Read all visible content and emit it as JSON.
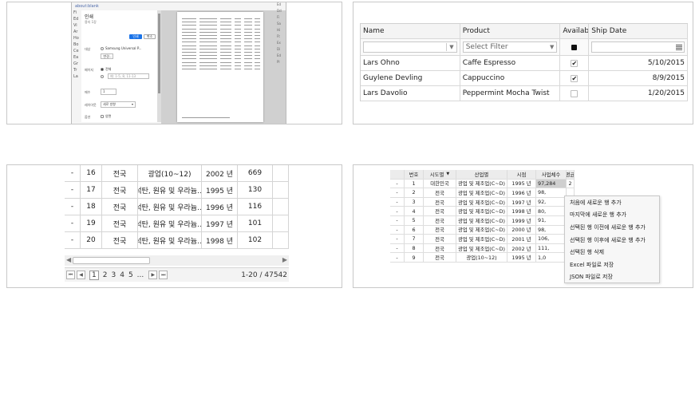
{
  "print_dialog": {
    "titlebar": "about:blank",
    "left_labels": [
      "Fi",
      "Ed",
      "Vi",
      "Ar",
      "Ho",
      "Bo",
      "Ce",
      "Ea",
      "Gr",
      "Tr",
      "La"
    ],
    "heading": "인쇄",
    "sub": "용지 1장",
    "print_btn": "인쇄",
    "cancel_btn": "취소",
    "dest_label": "대상",
    "dest_value": "Samsung Universal P...",
    "change_btn": "변경...",
    "pages_label": "페이지",
    "pages_all": "전체",
    "pages_example": "예: 1-5, 8, 11-13",
    "copies_label": "매수",
    "copies_value": "1",
    "layout_label": "레이아웃",
    "layout_value": "세로 방향",
    "color_label": "옵션",
    "color_value": "양면",
    "right_labels": [
      "Ed",
      "Dd",
      "Fi",
      "Sa",
      "Hi",
      "Ft",
      "Ex",
      "Di",
      "Ed",
      "Pl"
    ]
  },
  "filter_grid": {
    "columns": [
      "Name",
      "Product",
      "Available",
      "Ship Date"
    ],
    "filter_placeholder": "Select Filter",
    "rows": [
      {
        "name": "Lars Ohno",
        "product": "Caffe Espresso",
        "available": true,
        "date": "5/10/2015"
      },
      {
        "name": "Guylene Devling",
        "product": "Cappuccino",
        "available": true,
        "date": "8/9/2015"
      },
      {
        "name": "Lars Davolio",
        "product": "Peppermint Mocha Twist",
        "available": false,
        "date": "1/20/2015"
      }
    ]
  },
  "paged_table": {
    "rows": [
      {
        "d": "-",
        "no": "16",
        "region": "전국",
        "industry": "광업(10~12)",
        "year": "2002 년",
        "value": "669"
      },
      {
        "d": "-",
        "no": "17",
        "region": "전국",
        "industry": "석탄, 원유 및 우라늄...",
        "year": "1995 년",
        "value": "130"
      },
      {
        "d": "-",
        "no": "18",
        "region": "전국",
        "industry": "석탄, 원유 및 우라늄...",
        "year": "1996 년",
        "value": "116"
      },
      {
        "d": "-",
        "no": "19",
        "region": "전국",
        "industry": "석탄, 원유 및 우라늄...",
        "year": "1997 년",
        "value": "101"
      },
      {
        "d": "-",
        "no": "20",
        "region": "전국",
        "industry": "석탄, 원유 및 우라늄...",
        "year": "1998 년",
        "value": "102"
      }
    ],
    "pager": {
      "first": "⏮",
      "prev": "◀",
      "pages": [
        "1",
        "2",
        "3",
        "4",
        "5"
      ],
      "current": "1",
      "more": "...",
      "next": "▶",
      "last": "⏭",
      "info": "1-20 / 47542"
    }
  },
  "context_grid": {
    "columns": [
      "번호",
      "시도별",
      "산업별",
      "시점",
      "사업체수",
      "평균"
    ],
    "rows": [
      {
        "d": "-",
        "no": "1",
        "region": "대한민국",
        "industry": "광업 및 제조업(C~D)",
        "year": "1995 년",
        "cnt": "97,284",
        "ex": "2"
      },
      {
        "d": "-",
        "no": "2",
        "region": "전국",
        "industry": "광업 및 제조업(C~D)",
        "year": "1996 년",
        "cnt": "98,",
        "ex": ""
      },
      {
        "d": "-",
        "no": "3",
        "region": "전국",
        "industry": "광업 및 제조업(C~D)",
        "year": "1997 년",
        "cnt": "92,",
        "ex": ""
      },
      {
        "d": "-",
        "no": "4",
        "region": "전국",
        "industry": "광업 및 제조업(C~D)",
        "year": "1998 년",
        "cnt": "80,",
        "ex": ""
      },
      {
        "d": "-",
        "no": "5",
        "region": "전국",
        "industry": "광업 및 제조업(C~D)",
        "year": "1999 년",
        "cnt": "91,",
        "ex": ""
      },
      {
        "d": "-",
        "no": "6",
        "region": "전국",
        "industry": "광업 및 제조업(C~D)",
        "year": "2000 년",
        "cnt": "98,",
        "ex": ""
      },
      {
        "d": "-",
        "no": "7",
        "region": "전국",
        "industry": "광업 및 제조업(C~D)",
        "year": "2001 년",
        "cnt": "106,",
        "ex": ""
      },
      {
        "d": "-",
        "no": "8",
        "region": "전국",
        "industry": "광업 및 제조업(C~D)",
        "year": "2002 년",
        "cnt": "111,",
        "ex": ""
      },
      {
        "d": "-",
        "no": "9",
        "region": "전국",
        "industry": "광업(10~12)",
        "year": "1995 년",
        "cnt": "1,0",
        "ex": ""
      }
    ],
    "menu": [
      "처음에 새로운 행 추가",
      "마지막에 새로운 행 추가",
      "선택된 행 이전에 새로운 행 추가",
      "선택된 행 이후에 새로운 행 추가",
      "선택된 행 삭제",
      "Excel 파일로 저장",
      "JSON 파일로 저장"
    ]
  }
}
